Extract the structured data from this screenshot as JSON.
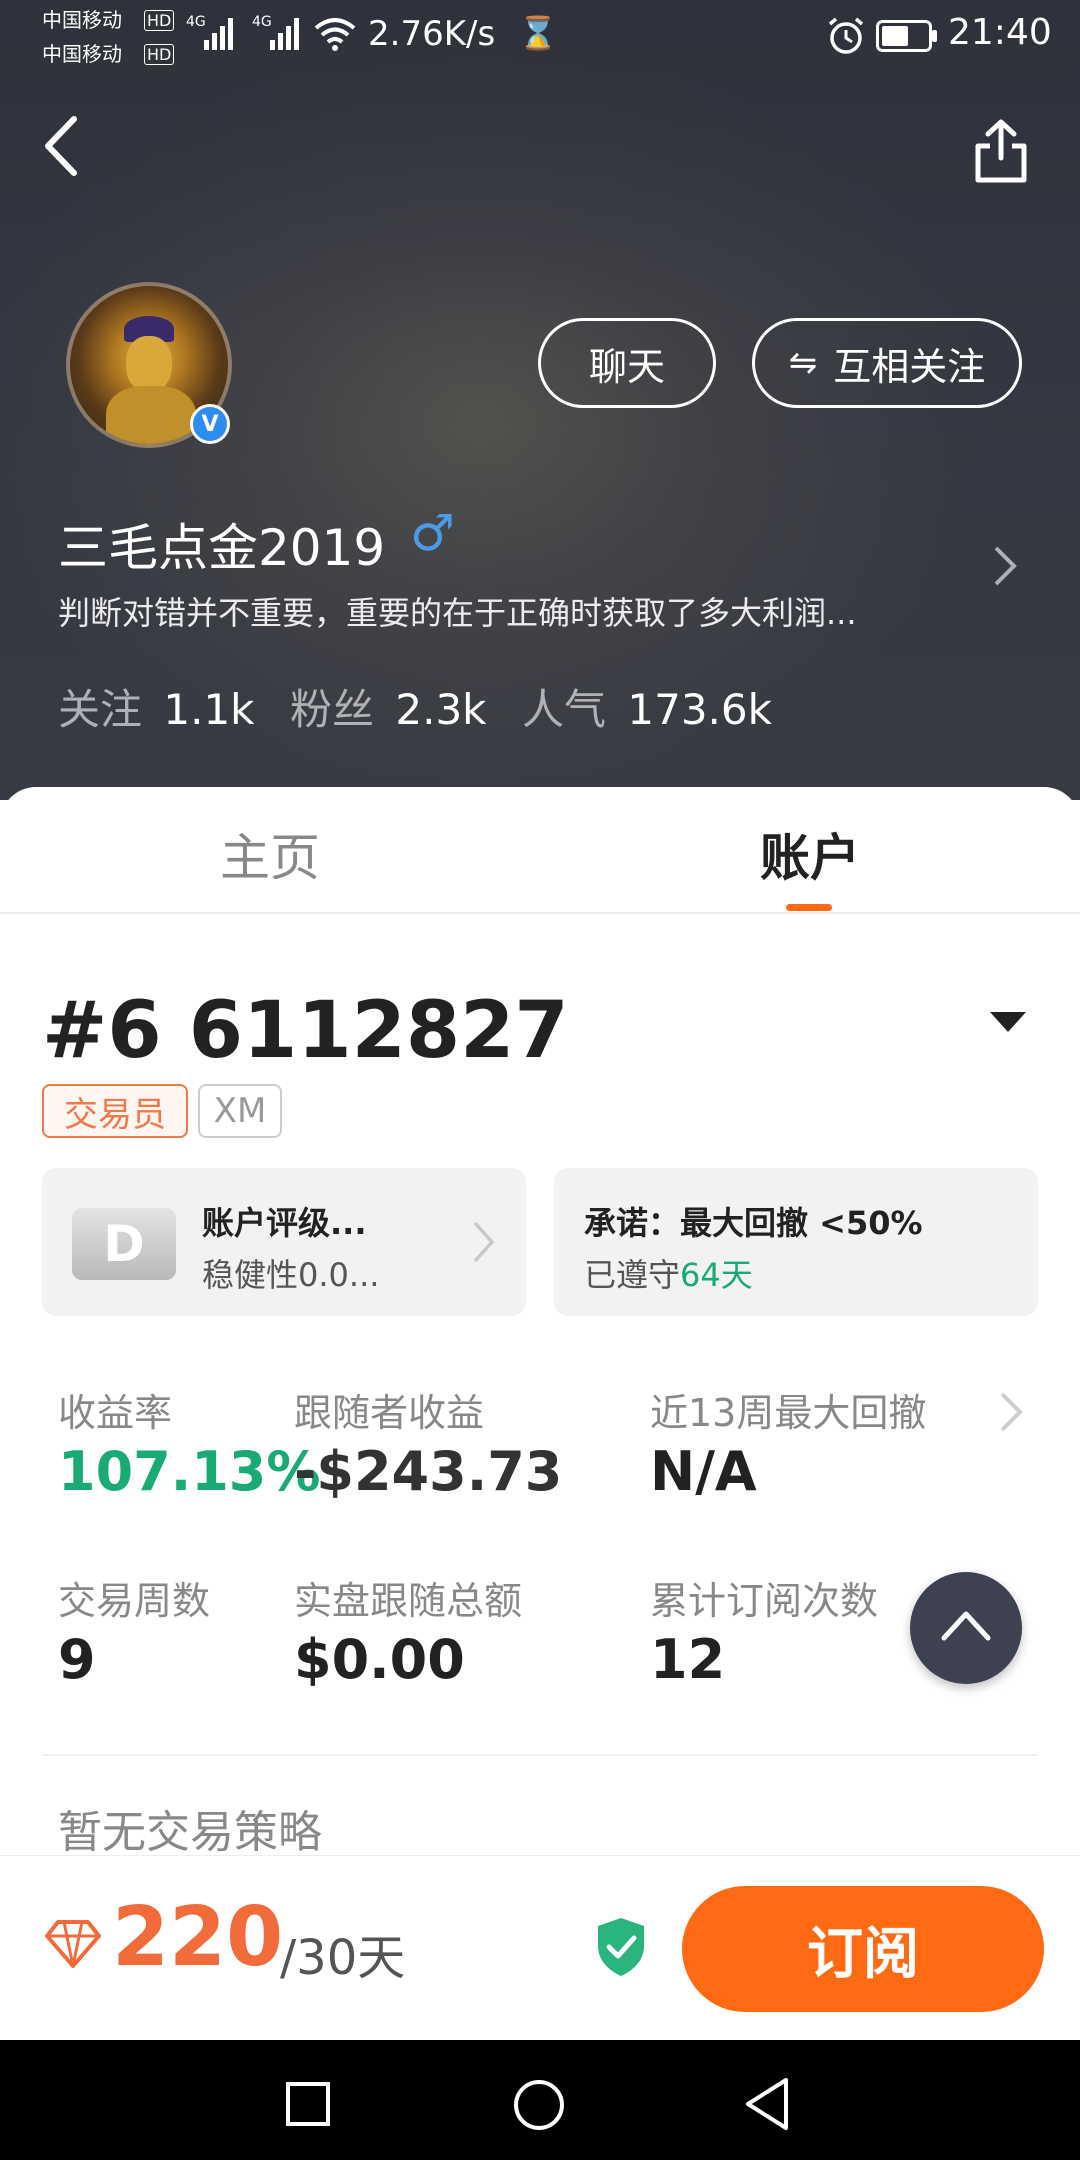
{
  "status_bar": {
    "carrier1": "中国移动",
    "carrier2": "中国移动",
    "hd": "HD",
    "net": "4G",
    "speed": "2.76K/s",
    "time": "21:40"
  },
  "profile": {
    "chat_label": "聊天",
    "follow_icon": "⇋",
    "follow_label": "互相关注",
    "name": "三毛点金2019",
    "gender_icon": "♂",
    "verified_badge": "V",
    "bio": "判断对错并不重要，重要的在于正确时获取了多大利润...",
    "stats": [
      {
        "label": "关注",
        "value": "1.1k"
      },
      {
        "label": "粉丝",
        "value": "2.3k"
      },
      {
        "label": "人气",
        "value": "173.6k"
      }
    ]
  },
  "tabs": [
    {
      "label": "主页",
      "active": false
    },
    {
      "label": "账户",
      "active": true
    }
  ],
  "account": {
    "id": "#6 6112827",
    "tag_trader": "交易员",
    "tag_broker": "XM",
    "rating_badge": "D",
    "rating_title": "账户评级...",
    "rating_sub": "稳健性0.0...",
    "promise_title": "承诺：最大回撤 <50%",
    "promise_sub_prefix": "已遵守",
    "promise_sub_days": "64天"
  },
  "metrics": [
    {
      "label": "收益率",
      "value": "107.13%",
      "color": "#1aab75"
    },
    {
      "label": "跟随者收益",
      "value": "-$243.73",
      "color": "#333333"
    },
    {
      "label": "近13周最大回撤",
      "value": "N/A",
      "color": "#222222"
    },
    {
      "label": "交易周数",
      "value": "9",
      "color": "#222222"
    },
    {
      "label": "实盘跟随总额",
      "value": "$0.00",
      "color": "#222222"
    },
    {
      "label": "累计订阅次数",
      "value": "12",
      "color": "#222222"
    }
  ],
  "strategy_note": "暂无交易策略",
  "subscribe": {
    "price": "220",
    "period": "/30天",
    "button": "订阅"
  },
  "colors": {
    "accent": "#ff6a13",
    "green": "#1aab75",
    "price": "#f26b3a"
  }
}
